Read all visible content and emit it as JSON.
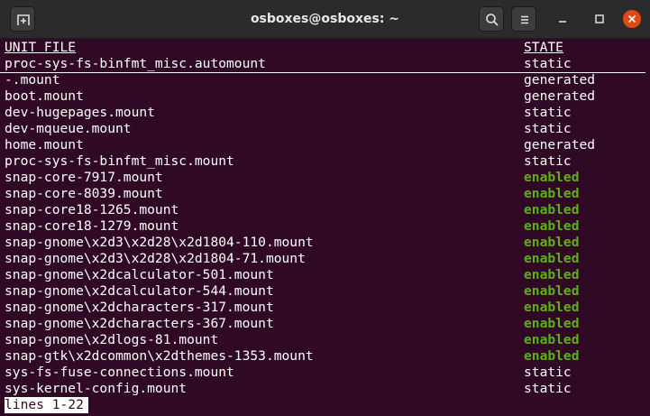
{
  "window": {
    "title": "osboxes@osboxes: ~",
    "buttons": {
      "new_tab": "new-tab-icon",
      "search": "search-icon",
      "menu": "hamburger-menu-icon",
      "minimize": "minimize-icon",
      "maximize": "maximize-icon",
      "close": "close-icon"
    },
    "colors": {
      "terminal_bg": "#300a24",
      "enabled_text": "#5fae1b",
      "close_button": "#df4a16"
    }
  },
  "terminal": {
    "header": {
      "col1": "UNIT FILE",
      "col2": "STATE"
    },
    "rows": [
      {
        "unit": "proc-sys-fs-binfmt_misc.automount",
        "state": "static"
      },
      {
        "unit": "-.mount",
        "state": "generated"
      },
      {
        "unit": "boot.mount",
        "state": "generated"
      },
      {
        "unit": "dev-hugepages.mount",
        "state": "static"
      },
      {
        "unit": "dev-mqueue.mount",
        "state": "static"
      },
      {
        "unit": "home.mount",
        "state": "generated"
      },
      {
        "unit": "proc-sys-fs-binfmt_misc.mount",
        "state": "static"
      },
      {
        "unit": "snap-core-7917.mount",
        "state": "enabled"
      },
      {
        "unit": "snap-core-8039.mount",
        "state": "enabled"
      },
      {
        "unit": "snap-core18-1265.mount",
        "state": "enabled"
      },
      {
        "unit": "snap-core18-1279.mount",
        "state": "enabled"
      },
      {
        "unit": "snap-gnome\\x2d3\\x2d28\\x2d1804-110.mount",
        "state": "enabled"
      },
      {
        "unit": "snap-gnome\\x2d3\\x2d28\\x2d1804-71.mount",
        "state": "enabled"
      },
      {
        "unit": "snap-gnome\\x2dcalculator-501.mount",
        "state": "enabled"
      },
      {
        "unit": "snap-gnome\\x2dcalculator-544.mount",
        "state": "enabled"
      },
      {
        "unit": "snap-gnome\\x2dcharacters-317.mount",
        "state": "enabled"
      },
      {
        "unit": "snap-gnome\\x2dcharacters-367.mount",
        "state": "enabled"
      },
      {
        "unit": "snap-gnome\\x2dlogs-81.mount",
        "state": "enabled"
      },
      {
        "unit": "snap-gtk\\x2dcommon\\x2dthemes-1353.mount",
        "state": "enabled"
      },
      {
        "unit": "sys-fs-fuse-connections.mount",
        "state": "static"
      },
      {
        "unit": "sys-kernel-config.mount",
        "state": "static"
      }
    ],
    "pager_status": "lines 1-22"
  }
}
